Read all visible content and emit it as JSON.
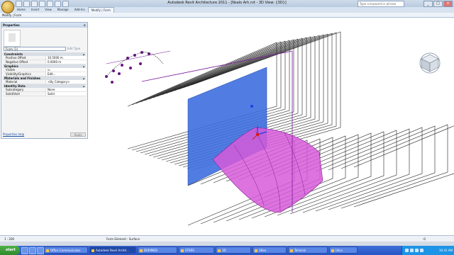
{
  "app": {
    "title": "Autodesk Revit Architecture 2011 - [Nsalo Arh.rvt - 3D View: {3D}]",
    "search_placeholder": "Type a keyword or phrase",
    "window_controls": [
      "_",
      "□",
      "×"
    ]
  },
  "ribbon": {
    "tabs": [
      "Home",
      "Insert",
      "View",
      "Manage",
      "Add-Ins",
      "Modify | Form"
    ],
    "active_tab": "Modify | Form",
    "context_label": "Modify | Form"
  },
  "properties": {
    "title": "Properties",
    "close_glyph": "×",
    "type_selector": "Form (1)",
    "edit_type_label": "Edit Type",
    "groups": [
      {
        "name": "Constraints",
        "rows": [
          {
            "key": "Positive Offset",
            "value": "10.5000 m"
          },
          {
            "key": "Negative Offset",
            "value": "0.0000 m"
          }
        ]
      },
      {
        "name": "Graphics",
        "rows": [
          {
            "key": "Visible",
            "value": "",
            "checkbox": true
          },
          {
            "key": "Visibility/Graphics Overrides",
            "value": "Edit..."
          }
        ]
      },
      {
        "name": "Materials and Finishes",
        "rows": [
          {
            "key": "Material",
            "value": "<By Category>"
          }
        ]
      },
      {
        "name": "Identity Data",
        "rows": [
          {
            "key": "Subcategory",
            "value": "None"
          },
          {
            "key": "Solid/Void",
            "value": "Solid"
          }
        ]
      }
    ],
    "help_link": "Properties help",
    "apply_label": "Apply"
  },
  "viewport": {
    "colors": {
      "wall_blue": "#3e6fe0",
      "form_magenta": "#d65ad9",
      "vertex_purple": "#6b1480",
      "line": "#222222"
    },
    "viewcube_icon": "viewcube-icon"
  },
  "status": {
    "scale": "1 : 200",
    "hint": "Form Element : Surface",
    "filter": ":0"
  },
  "taskbar": {
    "start_label": "start",
    "tasks": [
      "Office Communicator",
      "Autodesk Revit Archit...",
      "BORIMED",
      "STERS",
      "3D",
      "Ulleo",
      "Tehnicki",
      "Ulico"
    ],
    "active_task_index": 1,
    "clock": "10:41 AM"
  }
}
